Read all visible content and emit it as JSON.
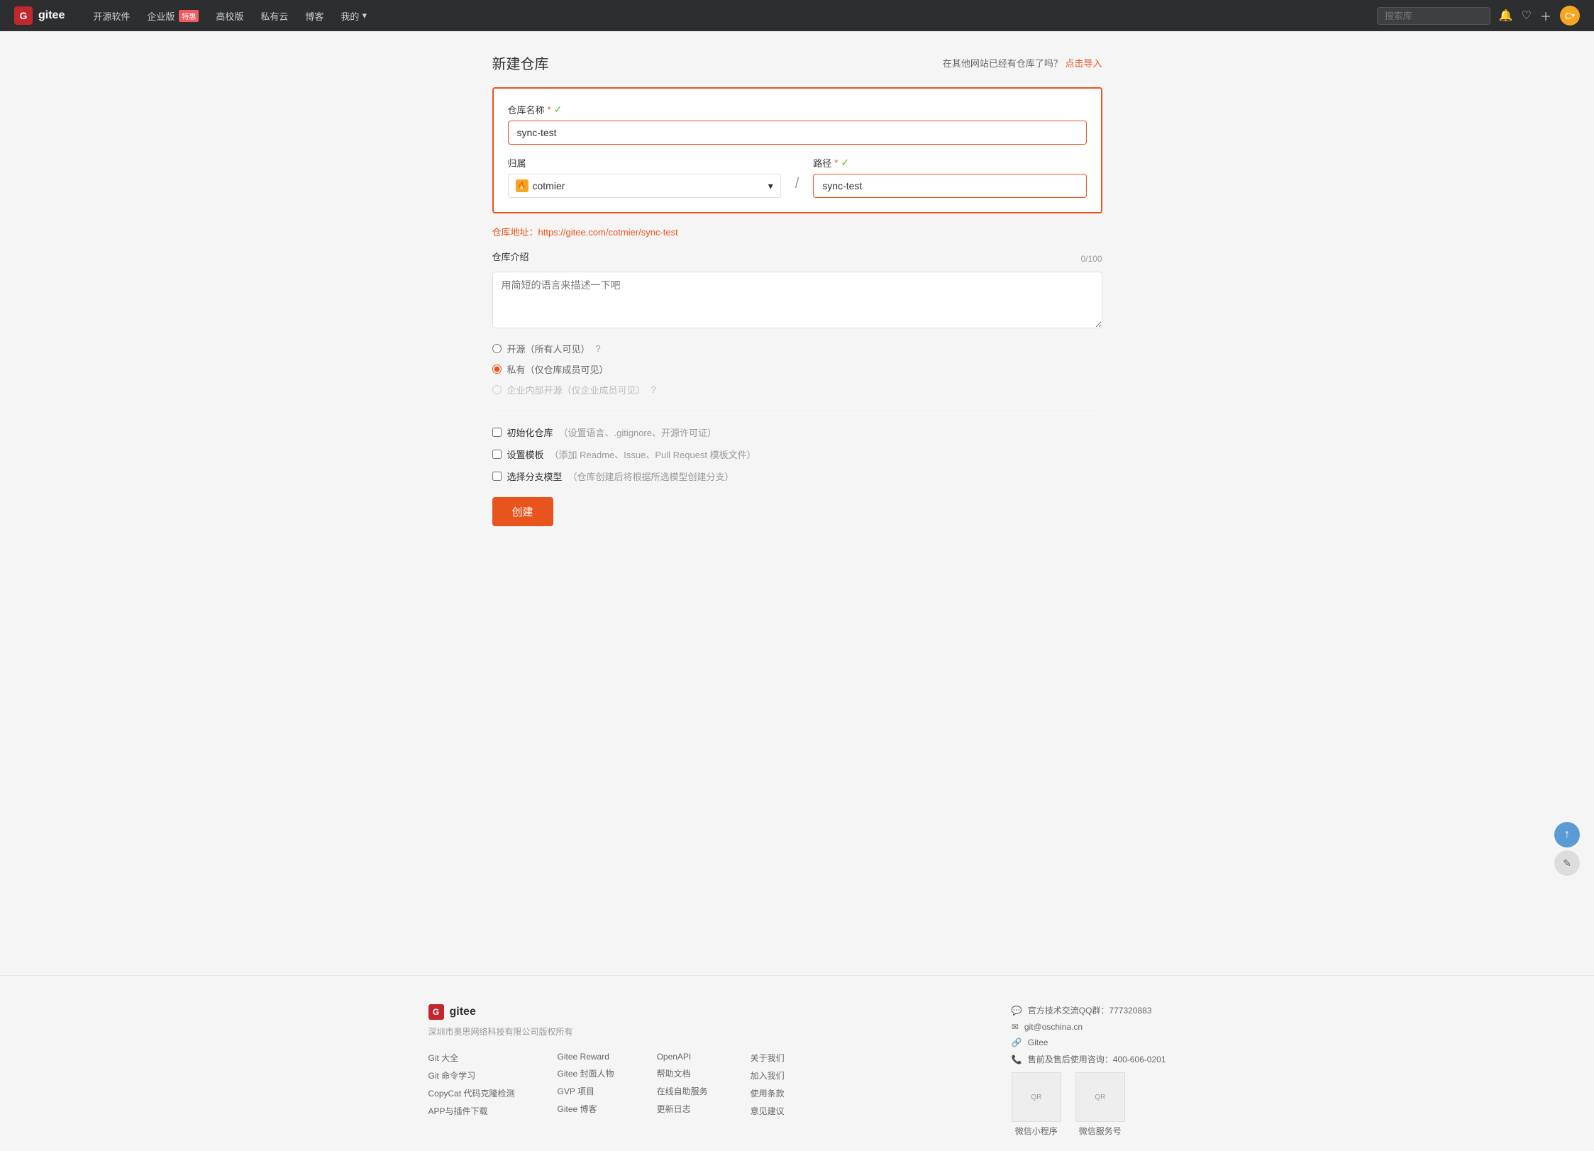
{
  "header": {
    "logo_text": "gitee",
    "nav_items": [
      {
        "label": "开源软件",
        "badge": null
      },
      {
        "label": "企业版",
        "badge": "特惠"
      },
      {
        "label": "高校版",
        "badge": null
      },
      {
        "label": "私有云",
        "badge": null
      },
      {
        "label": "博客",
        "badge": null
      },
      {
        "label": "我的",
        "badge": null,
        "has_dropdown": true
      }
    ],
    "search_placeholder": "搜索库",
    "avatar_text": "C"
  },
  "page": {
    "title": "新建仓库",
    "import_text": "在其他网站已经有仓库了吗？",
    "import_link": "点击导入"
  },
  "form": {
    "repo_name_label": "仓库名称",
    "repo_name_required": "*",
    "repo_name_value": "sync-test",
    "owner_label": "归属",
    "owner_value": "cotmier",
    "path_label": "路径",
    "path_required": "*",
    "path_value": "sync-test",
    "repo_url_prefix": "仓库地址：https://gitee.com/cotmier/sync-test",
    "desc_label": "仓库介绍",
    "desc_placeholder": "用简短的语言来描述一下吧",
    "desc_counter": "0/100",
    "visibility_options": [
      {
        "label": "开源（所有人可见）",
        "value": "public",
        "checked": false,
        "disabled": false
      },
      {
        "label": "私有（仅仓库成员可见）",
        "value": "private",
        "checked": true,
        "disabled": false
      },
      {
        "label": "企业内部开源（仅企业成员可见）",
        "value": "enterprise",
        "checked": false,
        "disabled": true
      }
    ],
    "checkboxes": [
      {
        "label": "初始化仓库",
        "sub_label": "（设置语言、.gitignore、开源许可证）",
        "checked": false
      },
      {
        "label": "设置模板",
        "sub_label": "（添加 Readme、Issue、Pull Request 模板文件）",
        "checked": false
      },
      {
        "label": "选择分支模型",
        "sub_label": "（仓库创建后将根据所选模型创建分支）",
        "checked": false
      }
    ],
    "create_button": "创建"
  },
  "footer": {
    "logo_text": "gitee",
    "copyright": "深圳市奥思网络科技有限公司版权所有",
    "cols": [
      {
        "links": [
          "Git 大全",
          "Git 命令学习",
          "CopyCat 代码克隆检测",
          "APP与插件下载"
        ]
      },
      {
        "links": [
          "Gitee Reward",
          "Gitee 封面人物",
          "GVP 项目",
          "Gitee 博客"
        ]
      },
      {
        "links": [
          "OpenAPI",
          "帮助文档",
          "在线自助服务",
          "更新日志"
        ]
      },
      {
        "links": [
          "关于我们",
          "加入我们",
          "使用条款",
          "意见建议"
        ]
      }
    ],
    "contact": [
      {
        "icon": "qq",
        "text": "官方技术交流QQ群：777320883"
      },
      {
        "icon": "email",
        "text": "git@oschina.cn"
      },
      {
        "icon": "gitee",
        "text": "Gitee"
      },
      {
        "icon": "phone",
        "text": "售前及售后使用咨询：400-606-0201"
      }
    ],
    "qr_labels": [
      "微信小程序",
      "微信服务号"
    ]
  }
}
